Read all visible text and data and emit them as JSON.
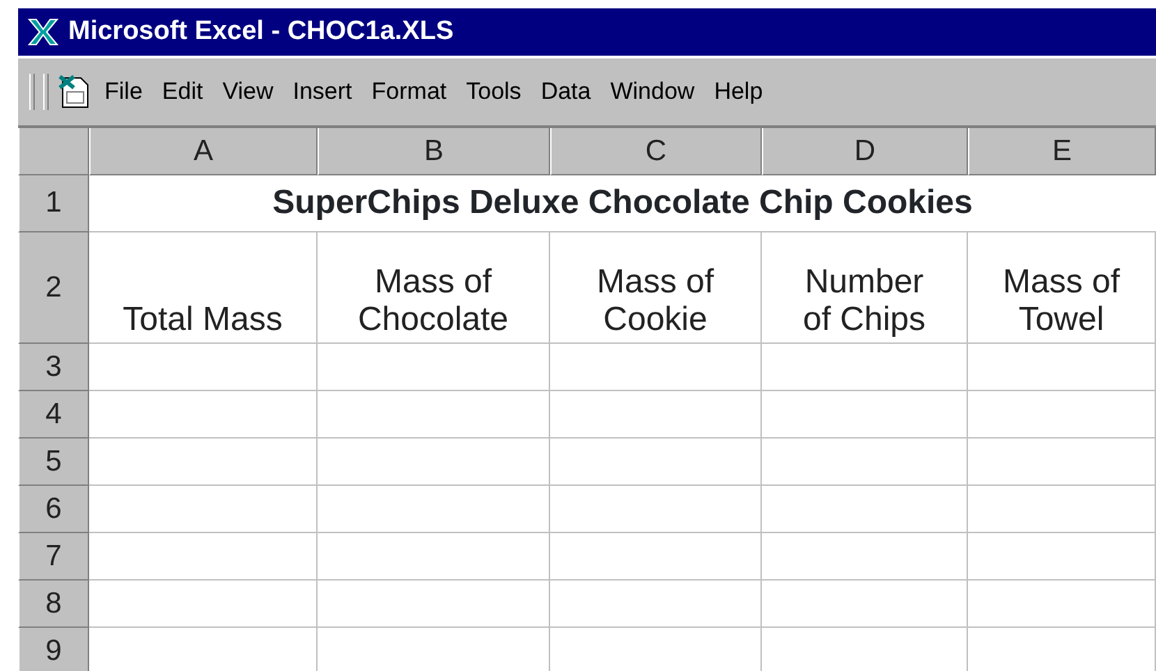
{
  "window": {
    "title": "Microsoft Excel - CHOC1a.XLS"
  },
  "menu": [
    {
      "label": "File"
    },
    {
      "label": "Edit"
    },
    {
      "label": "View"
    },
    {
      "label": "Insert"
    },
    {
      "label": "Format"
    },
    {
      "label": "Tools"
    },
    {
      "label": "Data"
    },
    {
      "label": "Window"
    },
    {
      "label": "Help"
    }
  ],
  "columns": [
    "A",
    "B",
    "C",
    "D",
    "E"
  ],
  "rows": [
    {
      "header": "1",
      "kind": "title",
      "text": "SuperChips Deluxe Chocolate Chip Cookies"
    },
    {
      "header": "2",
      "kind": "cells",
      "cells": [
        {
          "lines": [
            "Total Mass"
          ]
        },
        {
          "lines": [
            "Mass of",
            "Chocolate"
          ]
        },
        {
          "lines": [
            "Mass of",
            "Cookie"
          ]
        },
        {
          "lines": [
            "Number",
            "of Chips"
          ]
        },
        {
          "lines": [
            "Mass of",
            "Towel"
          ]
        }
      ]
    },
    {
      "header": "3"
    },
    {
      "header": "4"
    },
    {
      "header": "5"
    },
    {
      "header": "6"
    },
    {
      "header": "7"
    },
    {
      "header": "8"
    },
    {
      "header": "9"
    }
  ]
}
